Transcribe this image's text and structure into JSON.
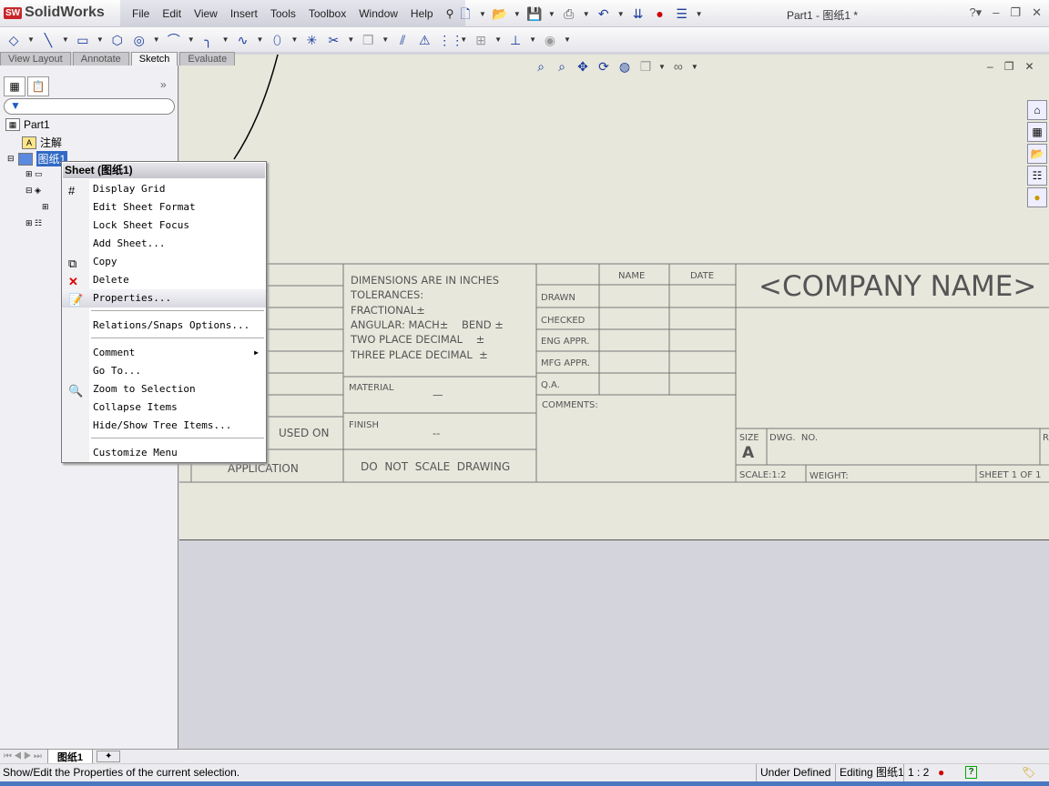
{
  "app": {
    "name": "SolidWorks",
    "logo_badge": "SW",
    "doc_title": "Part1 - 图纸1 *"
  },
  "menu": [
    "File",
    "Edit",
    "View",
    "Insert",
    "Tools",
    "Toolbox",
    "Window",
    "Help"
  ],
  "command_tabs": [
    "View Layout",
    "Annotate",
    "Sketch",
    "Evaluate"
  ],
  "tree": {
    "filter_placeholder": "",
    "items": [
      "Part1",
      "注解",
      "图纸1"
    ]
  },
  "context_menu": {
    "title": "Sheet (图纸1)",
    "items": [
      "Display Grid",
      "Edit Sheet Format",
      "Lock Sheet Focus",
      "Add Sheet...",
      "Copy",
      "Delete",
      "Properties...",
      "Relations/Snaps Options...",
      "Comment",
      "Go To...",
      "Zoom to Selection",
      "Collapse Items",
      "Hide/Show Tree Items...",
      "Customize Menu"
    ],
    "highlighted": "Properties..."
  },
  "title_block": {
    "dims": [
      "DIMENSIONS ARE IN INCHES",
      "TOLERANCES:",
      "FRACTIONAL±",
      "ANGULAR: MACH±    BEND ±",
      "TWO PLACE DECIMAL    ±",
      "THREE PLACE DECIMAL  ±"
    ],
    "material": "MATERIAL",
    "material_val": "—",
    "finish": "FINISH",
    "finish_val": "--",
    "no_scale": "DO  NOT  SCALE  DRAWING",
    "used_on": "USED ON",
    "application": "APPLICATION",
    "name": "NAME",
    "date": "DATE",
    "rows": [
      "DRAWN",
      "CHECKED",
      "ENG APPR.",
      "MFG APPR.",
      "Q.A."
    ],
    "comments": "COMMENTS:",
    "company": "<COMPANY NAME>",
    "size": "SIZE",
    "size_val": "A",
    "dwg_no": "DWG.  NO.",
    "rev": "R",
    "scale": "SCALE:1:2",
    "weight": "WEIGHT:",
    "sheet": "SHEET 1 OF 1"
  },
  "sheet_tab": "图纸1",
  "status": {
    "message": "Show/Edit the Properties of the current selection.",
    "state": "Under Defined",
    "editing": "Editing 图纸1",
    "scale": "1 : 2",
    "help": "?"
  }
}
